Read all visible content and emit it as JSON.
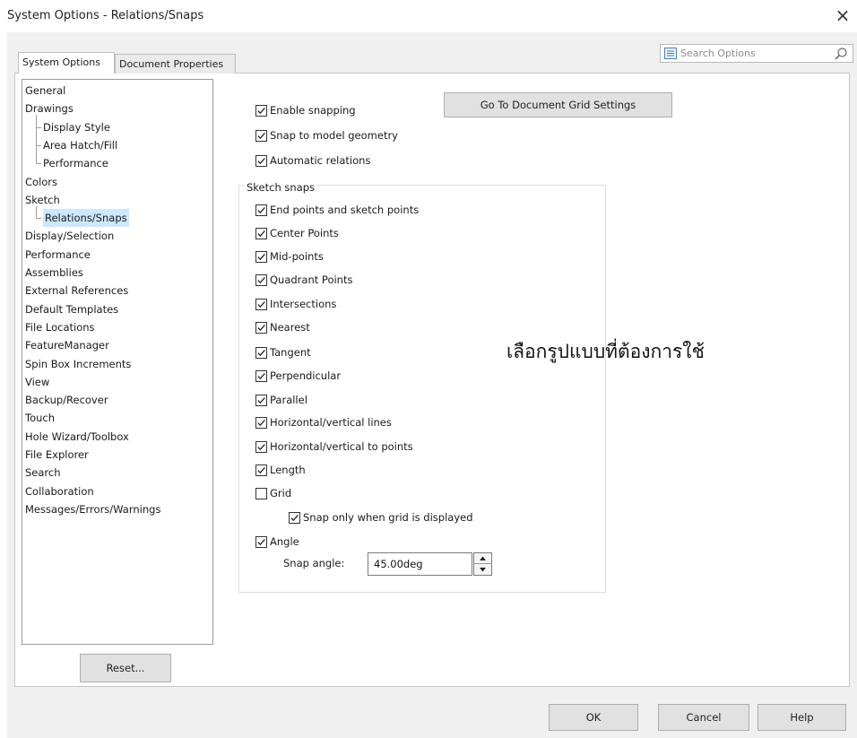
{
  "window": {
    "title": "System Options - Relations/Snaps",
    "close_label": "×"
  },
  "tabs": [
    {
      "label": "System Options",
      "active": true
    },
    {
      "label": "Document Properties",
      "active": false
    }
  ],
  "search": {
    "placeholder": "Search Options",
    "value": ""
  },
  "tree": [
    {
      "label": "General",
      "level": 0
    },
    {
      "label": "Drawings",
      "level": 0
    },
    {
      "label": "Display Style",
      "level": 1
    },
    {
      "label": "Area Hatch/Fill",
      "level": 1
    },
    {
      "label": "Performance",
      "level": 1
    },
    {
      "label": "Colors",
      "level": 0
    },
    {
      "label": "Sketch",
      "level": 0
    },
    {
      "label": "Relations/Snaps",
      "level": 1,
      "selected": true
    },
    {
      "label": "Display/Selection",
      "level": 0
    },
    {
      "label": "Performance",
      "level": 0
    },
    {
      "label": "Assemblies",
      "level": 0
    },
    {
      "label": "External References",
      "level": 0
    },
    {
      "label": "Default Templates",
      "level": 0
    },
    {
      "label": "File Locations",
      "level": 0
    },
    {
      "label": "FeatureManager",
      "level": 0
    },
    {
      "label": "Spin Box Increments",
      "level": 0
    },
    {
      "label": "View",
      "level": 0
    },
    {
      "label": "Backup/Recover",
      "level": 0
    },
    {
      "label": "Touch",
      "level": 0
    },
    {
      "label": "Hole Wizard/Toolbox",
      "level": 0
    },
    {
      "label": "File Explorer",
      "level": 0
    },
    {
      "label": "Search",
      "level": 0
    },
    {
      "label": "Collaboration",
      "level": 0
    },
    {
      "label": "Messages/Errors/Warnings",
      "level": 0
    }
  ],
  "reset_label": "Reset...",
  "grid_button_label": "Go To Document Grid Settings",
  "top_options": [
    {
      "label": "Enable snapping",
      "checked": true
    },
    {
      "label": "Snap to model geometry",
      "checked": true
    },
    {
      "label": "Automatic relations",
      "checked": true
    }
  ],
  "sketch_snaps": {
    "title": "Sketch snaps",
    "items": [
      {
        "label": "End points and sketch points",
        "checked": true
      },
      {
        "label": "Center Points",
        "checked": true
      },
      {
        "label": "Mid-points",
        "checked": true
      },
      {
        "label": "Quadrant Points",
        "checked": true
      },
      {
        "label": "Intersections",
        "checked": true
      },
      {
        "label": "Nearest",
        "checked": true
      },
      {
        "label": "Tangent",
        "checked": true
      },
      {
        "label": "Perpendicular",
        "checked": true
      },
      {
        "label": "Parallel",
        "checked": true
      },
      {
        "label": "Horizontal/vertical lines",
        "checked": true
      },
      {
        "label": "Horizontal/vertical to points",
        "checked": true
      },
      {
        "label": "Length",
        "checked": true
      },
      {
        "label": "Grid",
        "checked": false
      },
      {
        "label": "Snap only when grid is displayed",
        "checked": true,
        "indent": true
      },
      {
        "label": "Angle",
        "checked": true
      }
    ],
    "snap_angle_label": "Snap angle:",
    "snap_angle_value": "45.00deg"
  },
  "annotation_text": "เลือกรูปแบบที่ต้องการใช้",
  "footer": {
    "ok_label": "OK",
    "cancel_label": "Cancel",
    "help_label": "Help"
  },
  "colors": {
    "selection": "#cce8ff",
    "button_face": "#e1e1e1",
    "dialog_bg": "#f0f0f0"
  },
  "icons": {
    "close": "close-icon",
    "search_list": "list-icon",
    "search": "search-icon",
    "check": "check-icon",
    "spin_up": "spin-up-icon",
    "spin_down": "spin-down-icon"
  }
}
